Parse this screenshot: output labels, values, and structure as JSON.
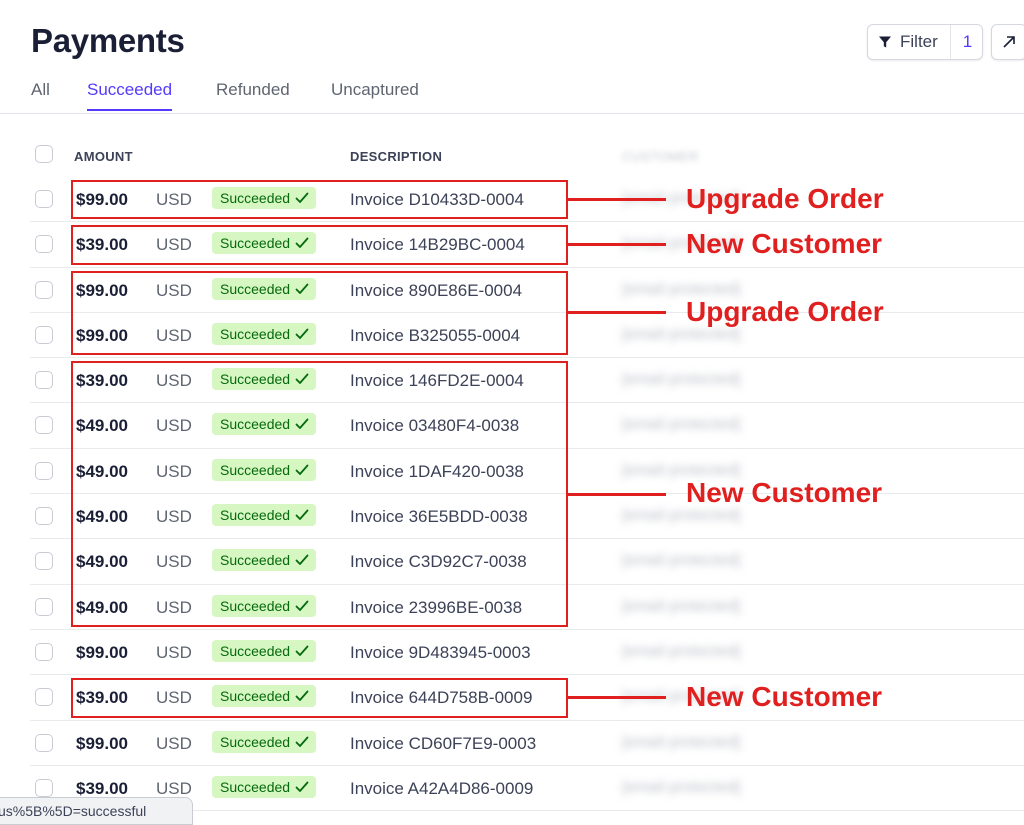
{
  "page": {
    "title": "Payments"
  },
  "toolbar": {
    "filter_label": "Filter",
    "filter_count": "1",
    "filter_icon": "funnel-icon",
    "export_icon": "arrow-up-right-icon"
  },
  "tabs": [
    {
      "label": "All",
      "active": false
    },
    {
      "label": "Succeeded",
      "active": true
    },
    {
      "label": "Refunded",
      "active": false
    },
    {
      "label": "Uncaptured",
      "active": false
    }
  ],
  "table": {
    "columns": {
      "amount": "AMOUNT",
      "description": "DESCRIPTION",
      "customer": "CUSTOMER"
    },
    "rows": [
      {
        "amount": "$99.00",
        "currency": "USD",
        "status": "Succeeded",
        "description": "Invoice D10433D-0004",
        "customer": "[email protected]"
      },
      {
        "amount": "$39.00",
        "currency": "USD",
        "status": "Succeeded",
        "description": "Invoice 14B29BC-0004",
        "customer": "[email protected]"
      },
      {
        "amount": "$99.00",
        "currency": "USD",
        "status": "Succeeded",
        "description": "Invoice 890E86E-0004",
        "customer": "[email protected]"
      },
      {
        "amount": "$99.00",
        "currency": "USD",
        "status": "Succeeded",
        "description": "Invoice B325055-0004",
        "customer": "[email protected]"
      },
      {
        "amount": "$39.00",
        "currency": "USD",
        "status": "Succeeded",
        "description": "Invoice 146FD2E-0004",
        "customer": "[email protected]"
      },
      {
        "amount": "$49.00",
        "currency": "USD",
        "status": "Succeeded",
        "description": "Invoice 03480F4-0038",
        "customer": "[email protected]"
      },
      {
        "amount": "$49.00",
        "currency": "USD",
        "status": "Succeeded",
        "description": "Invoice 1DAF420-0038",
        "customer": "[email protected]"
      },
      {
        "amount": "$49.00",
        "currency": "USD",
        "status": "Succeeded",
        "description": "Invoice 36E5BDD-0038",
        "customer": "[email protected]"
      },
      {
        "amount": "$49.00",
        "currency": "USD",
        "status": "Succeeded",
        "description": "Invoice C3D92C7-0038",
        "customer": "[email protected]"
      },
      {
        "amount": "$49.00",
        "currency": "USD",
        "status": "Succeeded",
        "description": "Invoice 23996BE-0038",
        "customer": "[email protected]"
      },
      {
        "amount": "$99.00",
        "currency": "USD",
        "status": "Succeeded",
        "description": "Invoice 9D483945-0003",
        "customer": "[email protected]"
      },
      {
        "amount": "$39.00",
        "currency": "USD",
        "status": "Succeeded",
        "description": "Invoice 644D758B-0009",
        "customer": "[email protected]"
      },
      {
        "amount": "$99.00",
        "currency": "USD",
        "status": "Succeeded",
        "description": "Invoice CD60F7E9-0003",
        "customer": "[email protected]"
      },
      {
        "amount": "$39.00",
        "currency": "USD",
        "status": "Succeeded",
        "description": "Invoice A42A4D86-0009",
        "customer": "[email protected]"
      }
    ]
  },
  "annotations": [
    {
      "label": "Upgrade Order",
      "rows": [
        0,
        0
      ]
    },
    {
      "label": "New Customer",
      "rows": [
        1,
        1
      ]
    },
    {
      "label": "Upgrade Order",
      "rows": [
        2,
        3
      ]
    },
    {
      "label": "New Customer",
      "rows": [
        4,
        9
      ]
    },
    {
      "label": "New Customer",
      "rows": [
        11,
        11
      ]
    }
  ],
  "annotation_color": "#e01f1f",
  "accent_color": "#533afd",
  "status_color": "#05690d",
  "status_bg": "#d7f7c2",
  "status_bar": {
    "url": "us%5B%5D=successful"
  }
}
